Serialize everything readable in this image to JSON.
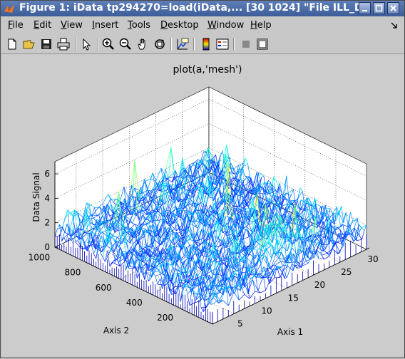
{
  "window": {
    "title": "Figure 1: iData tp294270=load(iData,... [30  1024] \"File ILL_D"
  },
  "menu": [
    "File",
    "Edit",
    "View",
    "Insert",
    "Tools",
    "Desktop",
    "Window",
    "Help"
  ],
  "menu_underline": [
    "F",
    "E",
    "V",
    "I",
    "T",
    "D",
    "W",
    "H"
  ],
  "toolbar_icons": [
    "new-file-icon",
    "open-folder-icon",
    "save-icon",
    "print-icon",
    "pointer-icon",
    "zoom-in-icon",
    "zoom-out-icon",
    "pan-icon",
    "rotate-3d-icon",
    "data-cursor-icon",
    "colorbar-icon",
    "legend-icon",
    "hide-plot-tools-icon",
    "show-plot-tools-icon"
  ],
  "chart_data": {
    "type": "mesh",
    "title": "plot(a,'mesh')",
    "xlabel": "Axis 1",
    "ylabel": "Axis 2",
    "zlabel": "Data Signal",
    "xticks": [
      5,
      10,
      15,
      20,
      25,
      30
    ],
    "yticks": [
      200,
      400,
      600,
      800,
      1000
    ],
    "zticks": [
      0,
      2,
      4,
      6
    ],
    "xlim": [
      1,
      30
    ],
    "ylim": [
      1,
      1024
    ],
    "zlim": [
      0,
      7
    ],
    "grid": true,
    "data_size": [
      30,
      1024
    ],
    "peak_z": 6.2
  }
}
